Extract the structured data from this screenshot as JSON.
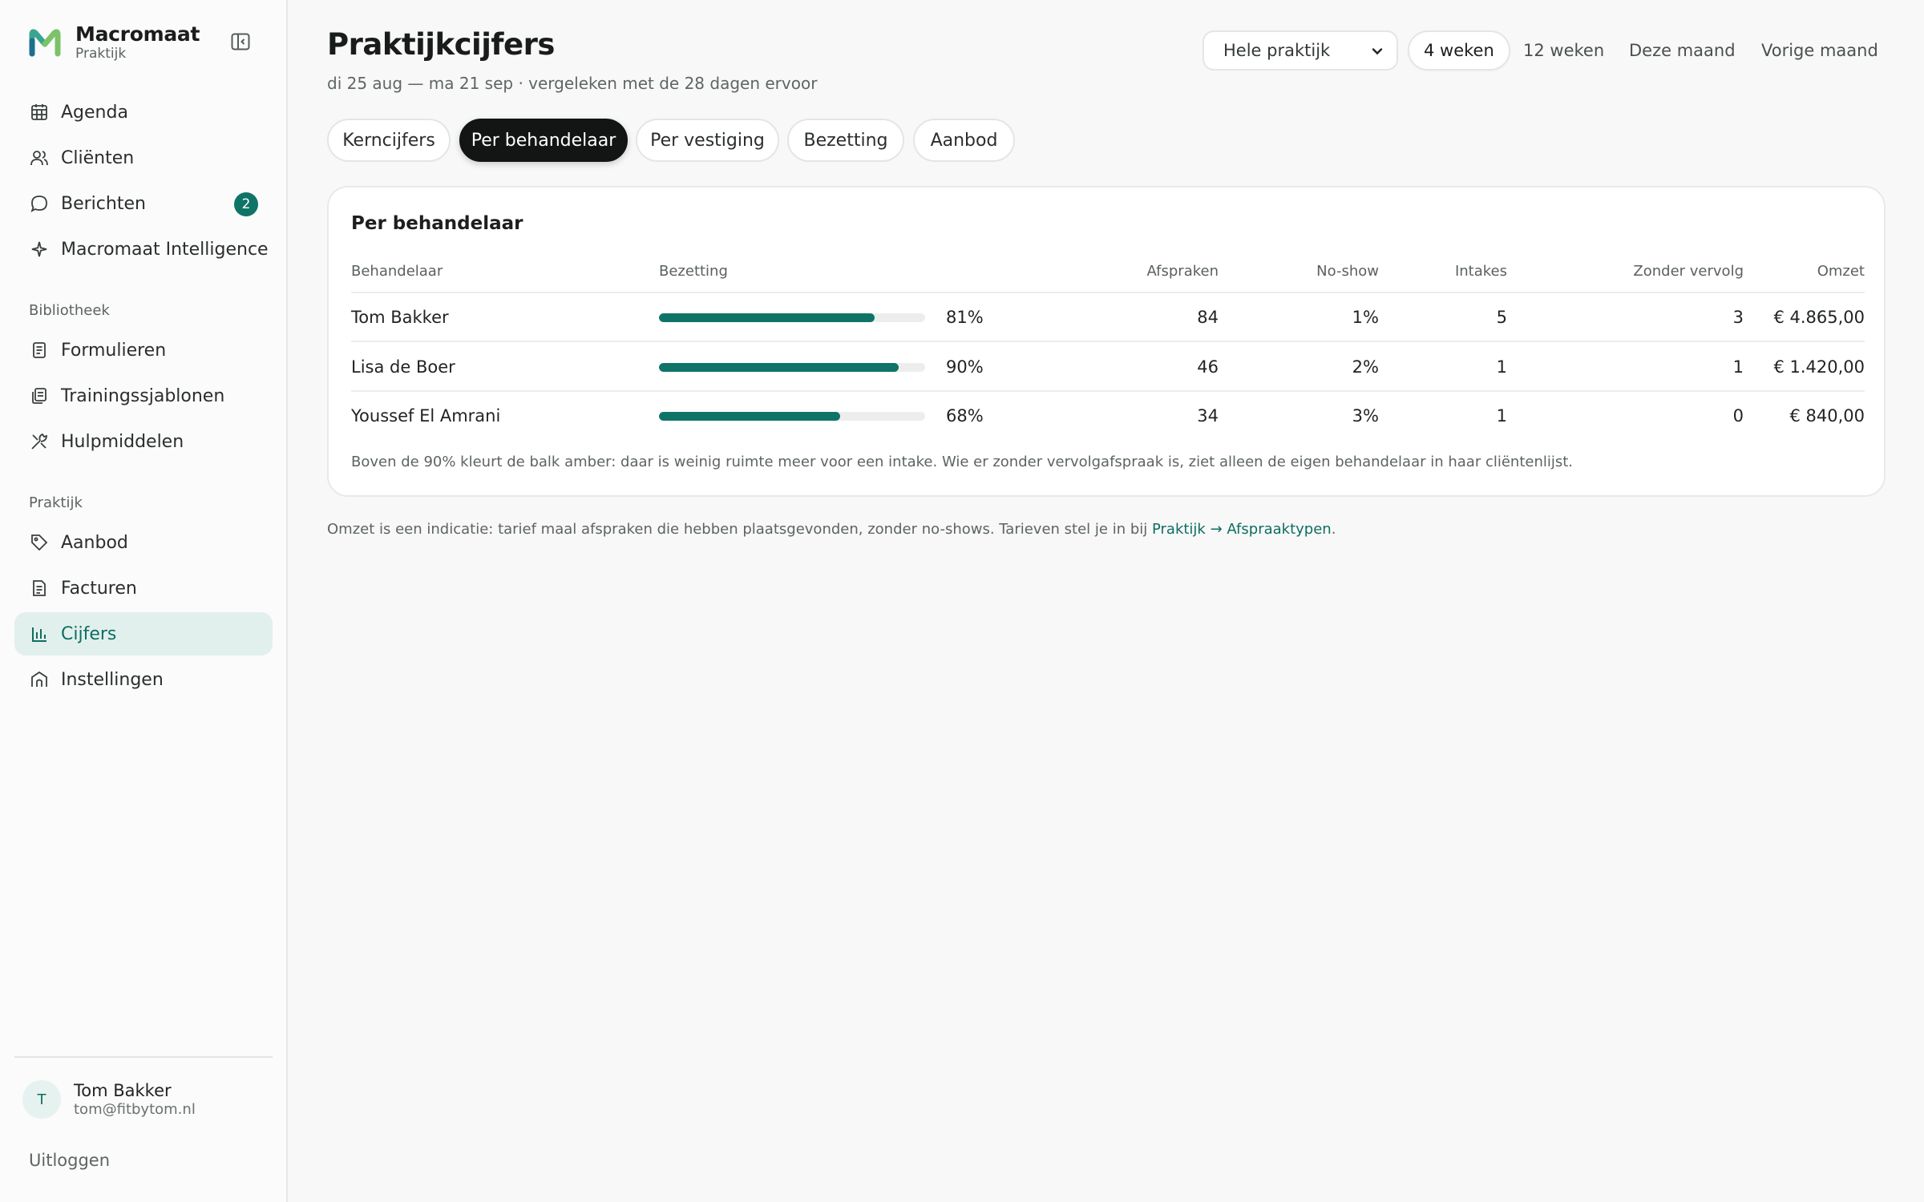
{
  "brand": {
    "name": "Macromaat",
    "subtitle": "Praktijk"
  },
  "nav": {
    "main": [
      {
        "label": "Agenda",
        "icon": "calendar-icon"
      },
      {
        "label": "Cliënten",
        "icon": "users-icon"
      },
      {
        "label": "Berichten",
        "icon": "message-icon",
        "badge": "2"
      },
      {
        "label": "Macromaat Intelligence",
        "icon": "sparkle-icon"
      }
    ],
    "library_label": "Bibliotheek",
    "library": [
      {
        "label": "Formulieren",
        "icon": "form-icon"
      },
      {
        "label": "Trainingssjablonen",
        "icon": "template-icon"
      },
      {
        "label": "Hulpmiddelen",
        "icon": "tools-icon"
      }
    ],
    "practice_label": "Praktijk",
    "practice": [
      {
        "label": "Aanbod",
        "icon": "tag-icon"
      },
      {
        "label": "Facturen",
        "icon": "invoice-icon"
      },
      {
        "label": "Cijfers",
        "icon": "bar-chart-icon",
        "active": true
      },
      {
        "label": "Instellingen",
        "icon": "building-icon"
      }
    ]
  },
  "user": {
    "initial": "T",
    "name": "Tom Bakker",
    "email": "tom@fitbytom.nl",
    "logout": "Uitloggen"
  },
  "header": {
    "title": "Praktijkcijfers",
    "subtitle": "di 25 aug — ma 21 sep · vergeleken met de 28 dagen ervoor",
    "scope_select": "Hele praktijk",
    "periods": [
      "4 weken",
      "12 weken",
      "Deze maand",
      "Vorige maand"
    ],
    "active_period": "4 weken"
  },
  "tabs": [
    "Kerncijfers",
    "Per behandelaar",
    "Per vestiging",
    "Bezetting",
    "Aanbod"
  ],
  "active_tab": "Per behandelaar",
  "table": {
    "title": "Per behandelaar",
    "columns": [
      "Behandelaar",
      "Bezetting",
      "Afspraken",
      "No-show",
      "Intakes",
      "Zonder vervolg",
      "Omzet"
    ],
    "rows": [
      {
        "name": "Tom Bakker",
        "occupancy": 0.81,
        "occupancy_label": "81%",
        "appointments": "84",
        "noshow": "1%",
        "intakes": "5",
        "no_followup": "3",
        "revenue": "€ 4.865,00"
      },
      {
        "name": "Lisa de Boer",
        "occupancy": 0.9,
        "occupancy_label": "90%",
        "appointments": "46",
        "noshow": "2%",
        "intakes": "1",
        "no_followup": "1",
        "revenue": "€ 1.420,00"
      },
      {
        "name": "Youssef El Amrani",
        "occupancy": 0.68,
        "occupancy_label": "68%",
        "appointments": "34",
        "noshow": "3%",
        "intakes": "1",
        "no_followup": "0",
        "revenue": "€ 840,00"
      }
    ],
    "note": "Boven de 90% kleurt de balk amber: daar is weinig ruimte meer voor een intake. Wie er zonder vervolgafspraak is, ziet alleen de eigen behandelaar in haar cliëntenlijst."
  },
  "footnote": {
    "text": "Omzet is een indicatie: tarief maal afspraken die hebben plaatsgevonden, zonder no-shows. Tarieven stel je in bij ",
    "link": "Praktijk → Afspraaktypen",
    "end": "."
  },
  "colors": {
    "accent": "#0f7467",
    "active_bg": "#e2f0ed",
    "tab_active": "#121514"
  }
}
